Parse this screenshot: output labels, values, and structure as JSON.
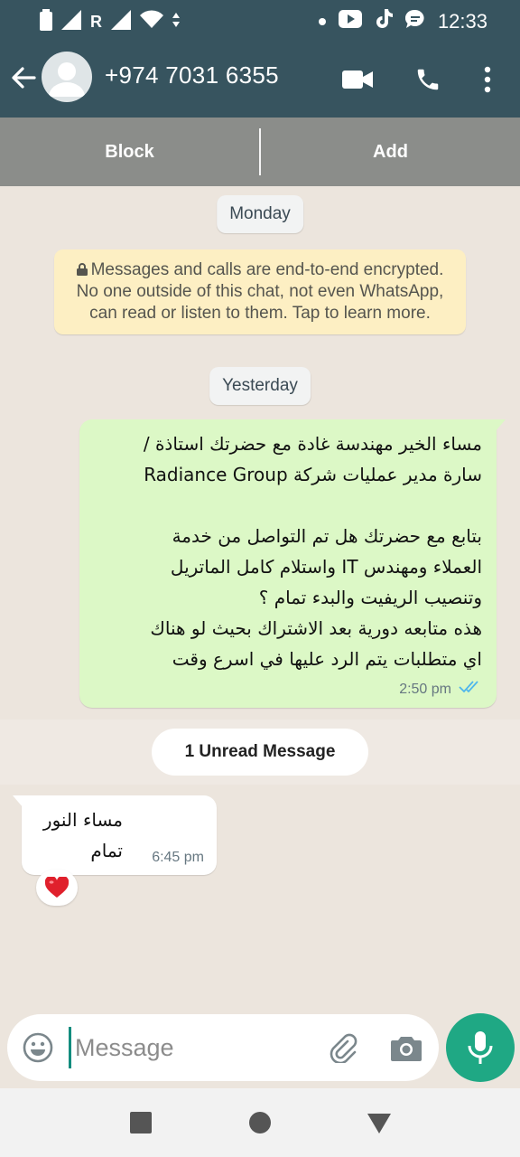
{
  "status_bar": {
    "network_letter": "R",
    "time": "12:33"
  },
  "header": {
    "contact_name": "+974 7031 6355",
    "icons": [
      "back-arrow-icon",
      "avatar",
      "video-call-icon",
      "phone-icon",
      "more-vert-icon"
    ]
  },
  "actions": {
    "block_label": "Block",
    "add_label": "Add"
  },
  "chat": {
    "date_monday": "Monday",
    "encryption_notice": "Messages and calls are end-to-end encrypted. No one outside of this chat, not even WhatsApp, can read or listen to them. Tap to learn more.",
    "date_yesterday": "Yesterday",
    "outgoing": {
      "text": "مساء الخير مهندسة غادة مع حضرتك استاذة /\nسارة مدير عمليات شركة Radiance Group\n\nبتابع مع حضرتك هل تم التواصل من خدمة\nالعملاء ومهندس IT واستلام كامل الماتريل\nوتنصيب الريفيت والبدء تمام ؟\nهذه متابعه دورية بعد الاشتراك بحيث لو هناك\nاي متطلبات يتم الرد عليها في اسرع وقت",
      "time": "2:50 pm",
      "status": "read"
    },
    "unread_label": "1 Unread Message",
    "incoming": {
      "text": "مساء النور\nتمام",
      "time": "6:45 pm",
      "reaction": "❤️"
    }
  },
  "composer": {
    "placeholder": "Message",
    "value": ""
  },
  "colors": {
    "header": "#37545f",
    "outgoing_bubble": "#dcf8c6",
    "accent": "#1fa884",
    "encryption_bg": "#fdefc3"
  }
}
